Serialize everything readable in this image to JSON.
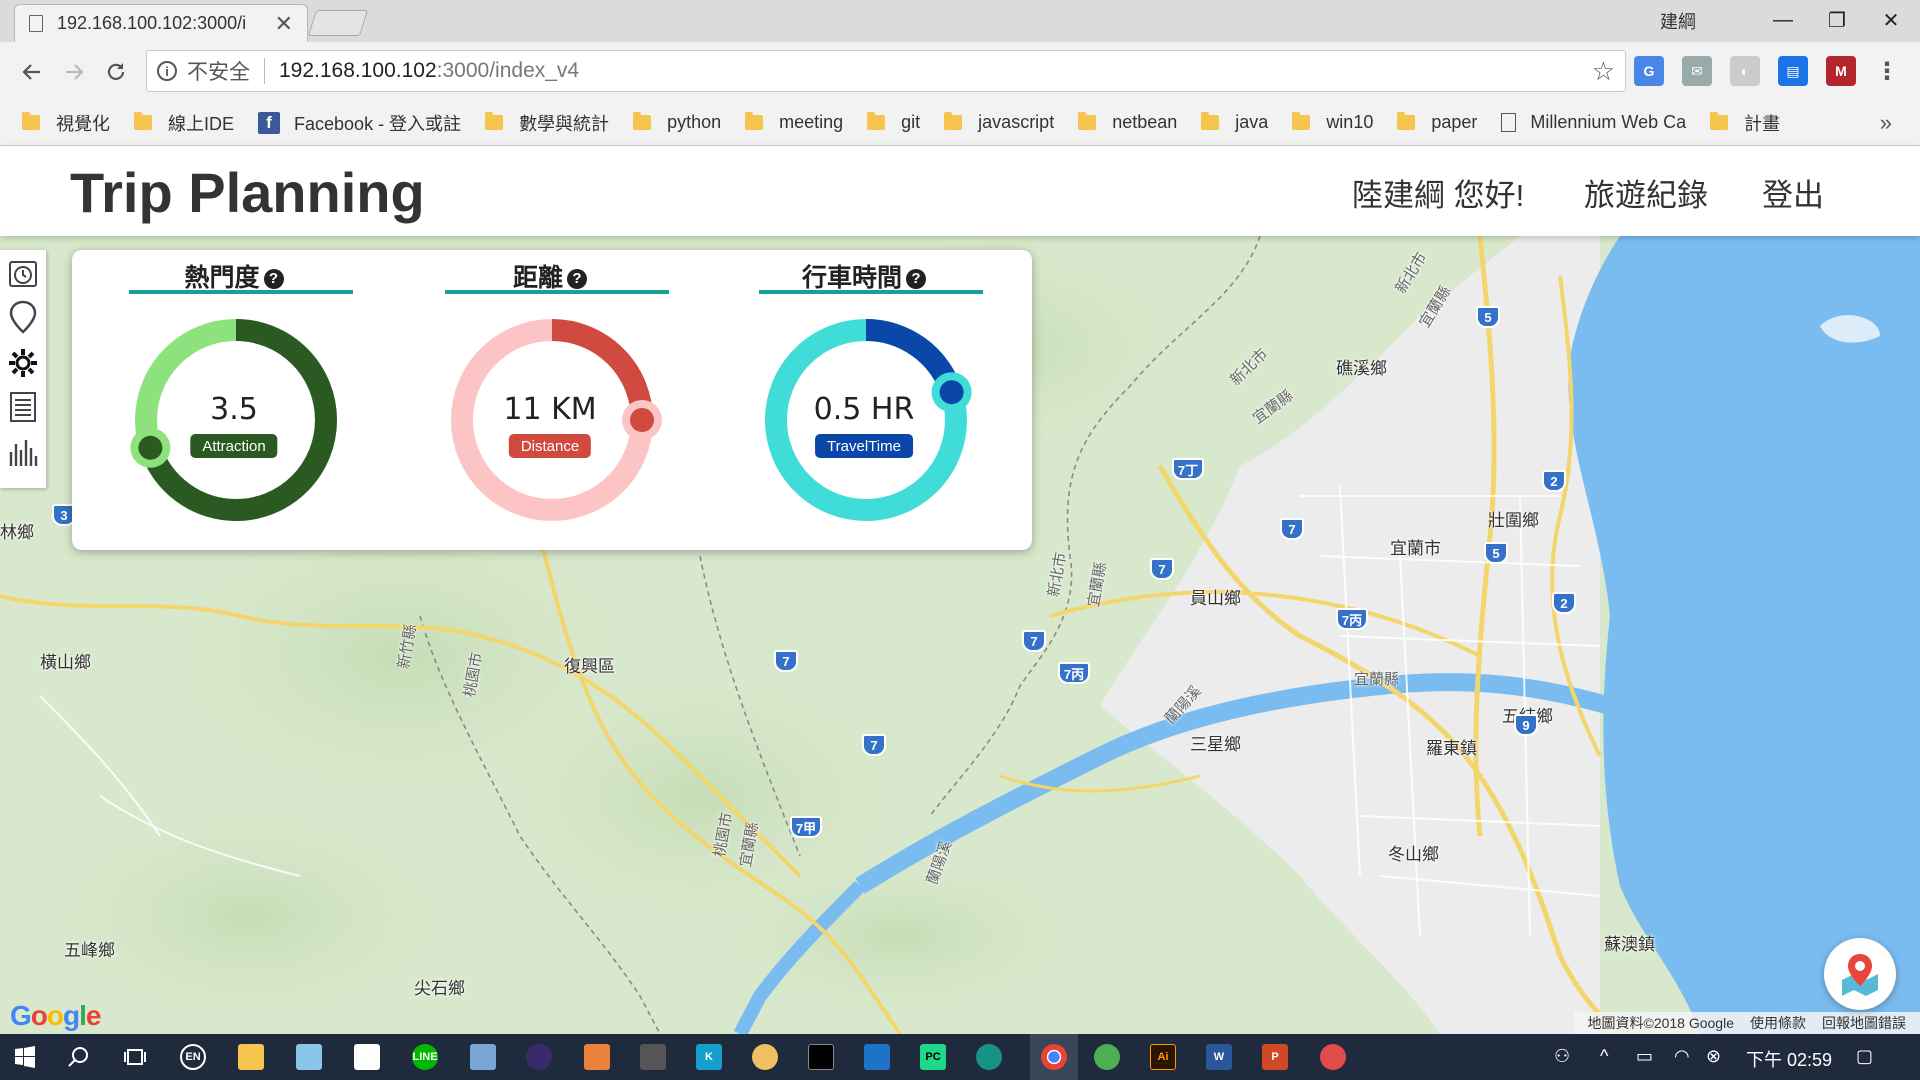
{
  "browser": {
    "tab_title": "192.168.100.102:3000/i",
    "tab_close": "✕",
    "window_user": "建綱",
    "minimize": "—",
    "restore": "❐",
    "close": "✕",
    "security_label": "不安全",
    "url_host": "192.168.100.102",
    "url_path": ":3000/index_v4",
    "bookmarks_more": "»"
  },
  "bookmarks": [
    {
      "label": "視覺化",
      "icon": "folder-icon"
    },
    {
      "label": "線上IDE",
      "icon": "folder-icon"
    },
    {
      "label": "Facebook - 登入或註",
      "icon": "facebook-icon"
    },
    {
      "label": "數學與統計",
      "icon": "folder-icon"
    },
    {
      "label": "python",
      "icon": "folder-icon"
    },
    {
      "label": "meeting",
      "icon": "folder-icon"
    },
    {
      "label": "git",
      "icon": "folder-icon"
    },
    {
      "label": "javascript",
      "icon": "folder-icon"
    },
    {
      "label": "netbean",
      "icon": "folder-icon"
    },
    {
      "label": "java",
      "icon": "folder-icon"
    },
    {
      "label": "win10",
      "icon": "folder-icon"
    },
    {
      "label": "paper",
      "icon": "folder-icon"
    },
    {
      "label": "Millennium Web Ca",
      "icon": "page-icon"
    },
    {
      "label": "計畫",
      "icon": "folder-icon"
    }
  ],
  "app": {
    "title": "Trip Planning",
    "greeting": "陸建綱 您好!",
    "nav_history": "旅遊紀錄",
    "nav_logout": "登出"
  },
  "gauges": [
    {
      "title": "熱門度",
      "value": "3.5",
      "badge": "Attraction",
      "fraction": 0.7,
      "track": "#8ee27e",
      "fill": "#2a5a22",
      "badge_color": "#2a5a22",
      "knob_ring": "#8ee27e",
      "knob": "#2a5a22"
    },
    {
      "title": "距離",
      "value": "11 KM",
      "badge": "Distance",
      "fraction": 0.25,
      "track": "#fcc4c4",
      "fill": "#d04a40",
      "badge_color": "#d04a40",
      "knob_ring": "#fcc4c4",
      "knob": "#d04a40"
    },
    {
      "title": "行車時間",
      "value": "0.5 HR",
      "badge": "TravelTime",
      "fraction": 0.2,
      "track": "#40dcd8",
      "fill": "#0a47a8",
      "badge_color": "#0a47a8",
      "knob_ring": "#40dcd8",
      "knob": "#0a47a8"
    }
  ],
  "map": {
    "labels": [
      {
        "text": "新北市",
        "cls": "small"
      },
      {
        "text": "宜蘭縣",
        "cls": "small"
      },
      {
        "text": "新北市",
        "cls": "small"
      },
      {
        "text": "宜蘭縣",
        "cls": "small"
      },
      {
        "text": "礁溪鄉",
        "cls": ""
      },
      {
        "text": "壯圍鄉",
        "cls": ""
      },
      {
        "text": "宜蘭市",
        "cls": ""
      },
      {
        "text": "員山鄉",
        "cls": ""
      },
      {
        "text": "林鄉",
        "cls": ""
      },
      {
        "text": "橫山鄉",
        "cls": ""
      },
      {
        "text": "復興區",
        "cls": ""
      },
      {
        "text": "新竹縣",
        "cls": "small"
      },
      {
        "text": "桃園市",
        "cls": "small"
      },
      {
        "text": "新北市",
        "cls": "small"
      },
      {
        "text": "宜蘭縣",
        "cls": "small"
      },
      {
        "text": "宜蘭縣",
        "cls": "small"
      },
      {
        "text": "五結鄉",
        "cls": ""
      },
      {
        "text": "三星鄉",
        "cls": ""
      },
      {
        "text": "羅東鎮",
        "cls": ""
      },
      {
        "text": "蘭陽溪",
        "cls": "small"
      },
      {
        "text": "冬山鄉",
        "cls": ""
      },
      {
        "text": "桃園市",
        "cls": "small"
      },
      {
        "text": "宜蘭縣",
        "cls": "small"
      },
      {
        "text": "蘭陽溪",
        "cls": "small"
      },
      {
        "text": "五峰鄉",
        "cls": ""
      },
      {
        "text": "尖石鄉",
        "cls": ""
      },
      {
        "text": "蘇澳鎮",
        "cls": ""
      }
    ],
    "routes": [
      "5",
      "7丁",
      "2",
      "3",
      "7",
      "7",
      "5",
      "2",
      "7",
      "7丙",
      "7",
      "7丙",
      "7",
      "9",
      "7",
      "7甲"
    ],
    "google": "Google",
    "attribution": [
      "地圖資料©2018 Google",
      "使用條款",
      "回報地圖錯誤"
    ]
  },
  "taskbar": {
    "lang": "EN",
    "clock": "下午 02:59"
  }
}
